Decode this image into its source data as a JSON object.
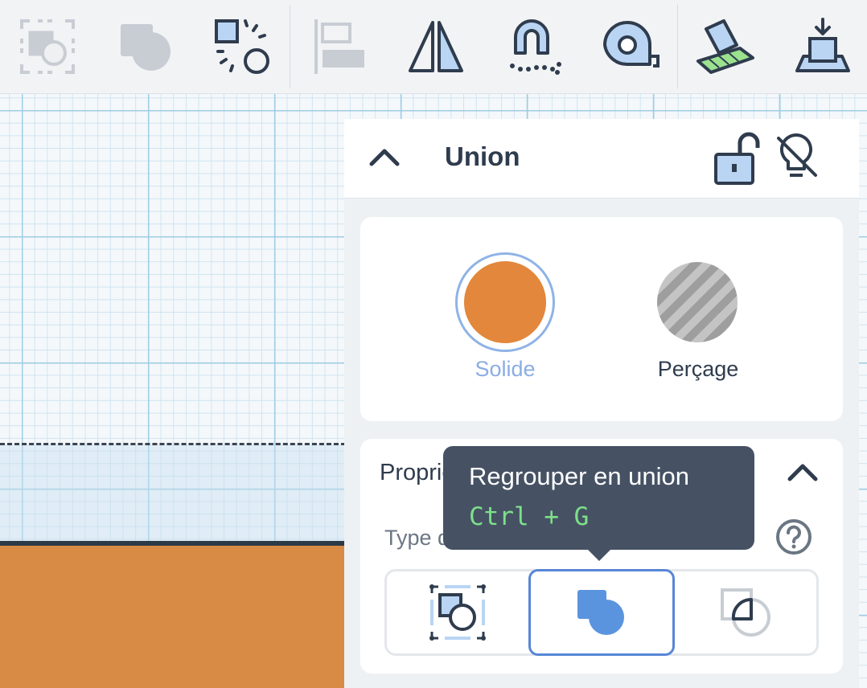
{
  "toolbar": {
    "tools": [
      {
        "icon": "group-icon",
        "enabled": false
      },
      {
        "icon": "ungroup-icon",
        "enabled": false
      },
      {
        "icon": "cruise-shapes-icon",
        "enabled": true
      },
      {
        "icon": "align-icon",
        "enabled": false
      },
      {
        "icon": "mirror-icon",
        "enabled": true
      },
      {
        "icon": "magnet-icon",
        "enabled": true
      },
      {
        "icon": "ruler-tape-icon",
        "enabled": true
      },
      {
        "icon": "workplane-icon",
        "enabled": true
      },
      {
        "icon": "import-icon",
        "enabled": true
      }
    ]
  },
  "inspector": {
    "title": "Union",
    "modes": {
      "solid_label": "Solide",
      "hole_label": "Perçage",
      "selected": "solid",
      "solid_color": "#e2873b"
    },
    "properties": {
      "title": "Propriétés",
      "group_type_label": "Type de groupe : union",
      "options": [
        {
          "icon": "group-outline-icon",
          "selected": false
        },
        {
          "icon": "union-icon",
          "selected": true
        },
        {
          "icon": "intersect-icon",
          "selected": false
        }
      ]
    }
  },
  "tooltip": {
    "title": "Regrouper en union",
    "shortcut": "Ctrl + G"
  },
  "colors": {
    "accent": "#5786d6",
    "shortcut": "#7de08a",
    "tooltip_bg": "#465264"
  }
}
